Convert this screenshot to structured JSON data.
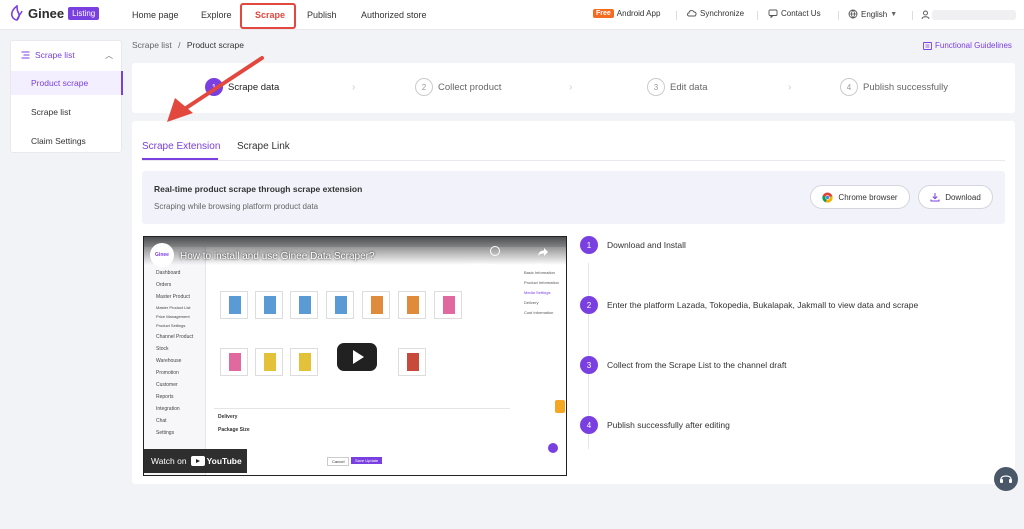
{
  "brand": {
    "name": "Ginee",
    "badge": "Listing"
  },
  "nav": {
    "home": "Home page",
    "explore": "Explore",
    "scrape": "Scrape",
    "publish": "Publish",
    "authorized": "Authorized store"
  },
  "header_right": {
    "free_badge": "Free",
    "android": "Android App",
    "sync": "Synchronize",
    "contact": "Contact Us",
    "language": "English"
  },
  "sidebar": {
    "title": "Scrape list",
    "items": [
      "Product scrape",
      "Scrape list",
      "Claim Settings"
    ]
  },
  "breadcrumb": {
    "parent": "Scrape list",
    "separator": "/",
    "current": "Product scrape"
  },
  "guidelines": "Functional Guidelines",
  "steps": [
    {
      "num": "1",
      "label": "Scrape data"
    },
    {
      "num": "2",
      "label": "Collect product"
    },
    {
      "num": "3",
      "label": "Edit data"
    },
    {
      "num": "4",
      "label": "Publish successfully"
    }
  ],
  "tabs": [
    "Scrape Extension",
    "Scrape Link"
  ],
  "extension": {
    "title": "Real-time product scrape through scrape extension",
    "subtitle": "Scraping while browsing platform product data",
    "chrome_btn": "Chrome browser",
    "download_btn": "Download"
  },
  "video": {
    "title": "How to install and use Ginee Data Scraper?",
    "watch_later": "Watch later",
    "share": "Share",
    "watch_on": "Watch on",
    "youtube": "YouTube",
    "channel": "Ginee",
    "sidebar_items": [
      "Dashboard",
      "Orders",
      "Master Product",
      "Master Product List",
      "Price Management",
      "Product Settings",
      "Channel Product",
      "Stock",
      "Warehouse",
      "Promotion",
      "Customer",
      "Reports",
      "Integration",
      "Chat",
      "Settings"
    ],
    "right_panel": [
      "Basic Information",
      "Product Information",
      "Media Settings",
      "Delivery",
      "Cost Information"
    ],
    "section_delivery": "Delivery",
    "section_package": "Package Size",
    "cancel": "Cancel",
    "save": "Save Update"
  },
  "instructions": [
    {
      "num": "1",
      "text": "Download and Install"
    },
    {
      "num": "2",
      "text": "Enter the platform Lazada, Tokopedia, Bukalapak, Jakmall to view data and scrape"
    },
    {
      "num": "3",
      "text": "Collect from the Scrape List to the channel draft"
    },
    {
      "num": "4",
      "text": "Publish successfully after editing"
    }
  ],
  "colors": {
    "accent": "#7a3fe0",
    "highlight": "#e2483d",
    "free": "#f36c21"
  }
}
